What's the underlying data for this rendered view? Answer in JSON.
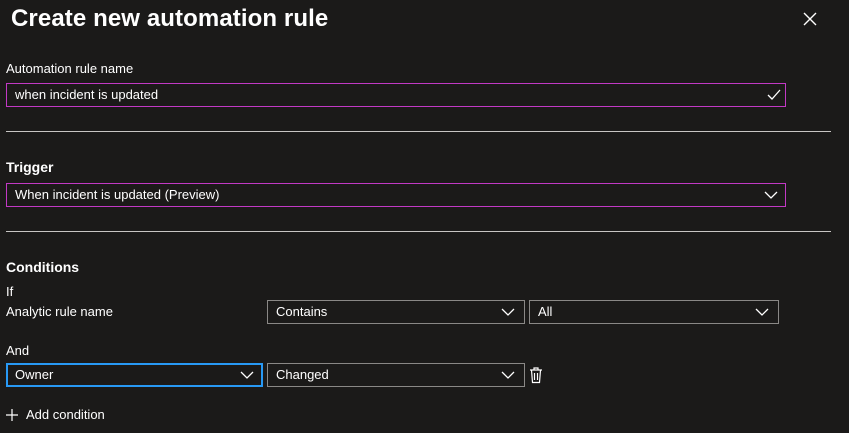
{
  "panel": {
    "title": "Create new automation rule",
    "close_icon": "close-icon"
  },
  "rule_name": {
    "label": "Automation rule name",
    "value": "when incident is updated",
    "valid_icon": "checkmark-icon"
  },
  "trigger": {
    "heading": "Trigger",
    "selected": "When incident is updated (Preview)"
  },
  "conditions": {
    "heading": "Conditions",
    "if_label": "If",
    "rows": [
      {
        "property": "Analytic rule name",
        "operator": "Contains",
        "value": "All"
      },
      {
        "connector": "And",
        "property": "Owner",
        "operator": "Changed",
        "delete_icon": "trash-icon"
      }
    ],
    "add_label": "Add condition",
    "add_icon": "plus-icon"
  },
  "colors": {
    "background": "#1b1a19",
    "accent_border": "#c239c5",
    "focus_border": "#2899f5",
    "input_border": "#8a8886",
    "divider": "#c8c6c4"
  }
}
